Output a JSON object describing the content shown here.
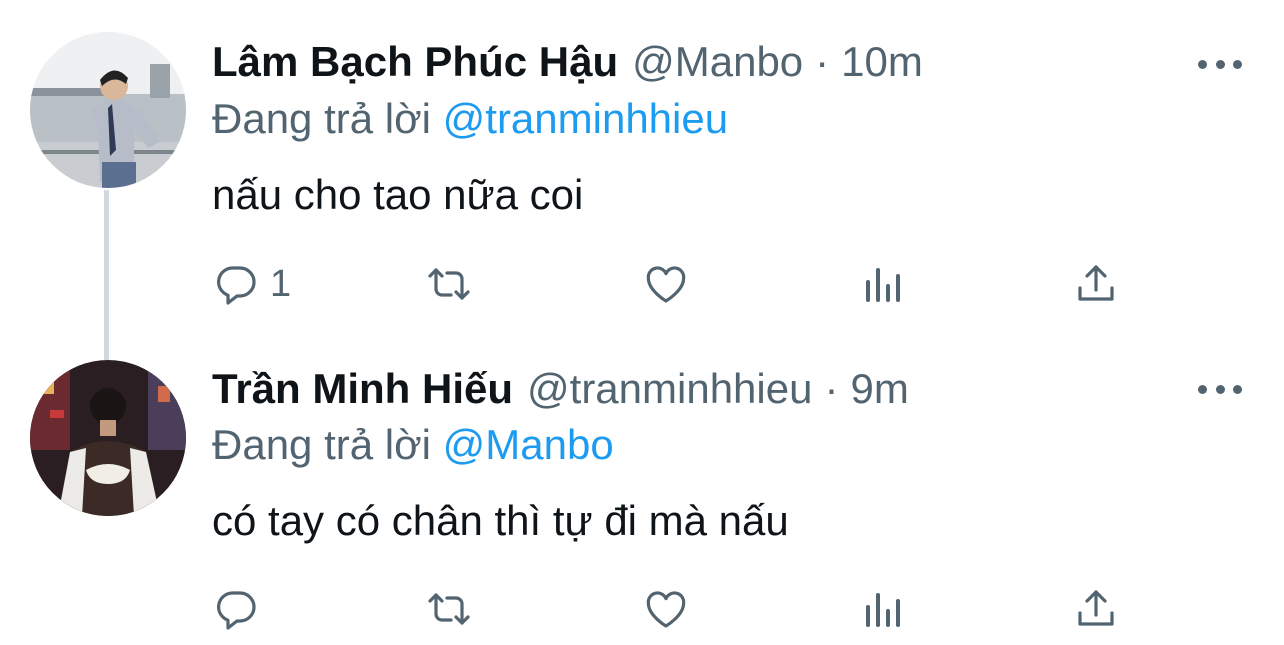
{
  "colors": {
    "text_primary": "#0f1419",
    "text_secondary": "#536471",
    "link": "#1d9bf0",
    "thread_line": "#cfd9de",
    "background": "#ffffff"
  },
  "tweets": [
    {
      "display_name": "Lâm Bạch Phúc Hậu",
      "handle": "@Manbo",
      "separator": "·",
      "time": "10m",
      "reply_prefix": "Đang trả lời",
      "reply_to": "@tranminhhieu",
      "text": "nấu cho tao nữa coi",
      "reply_count": "1",
      "icons": [
        "reply-icon",
        "retweet-icon",
        "like-icon",
        "views-icon",
        "share-icon",
        "more-icon"
      ]
    },
    {
      "display_name": "Trần Minh Hiếu",
      "handle": "@tranminhhieu",
      "separator": "·",
      "time": "9m",
      "reply_prefix": "Đang trả lời",
      "reply_to": "@Manbo",
      "text": "có tay có chân thì tự đi mà nấu",
      "reply_count": "",
      "icons": [
        "reply-icon",
        "retweet-icon",
        "like-icon",
        "views-icon",
        "share-icon",
        "more-icon"
      ]
    }
  ]
}
